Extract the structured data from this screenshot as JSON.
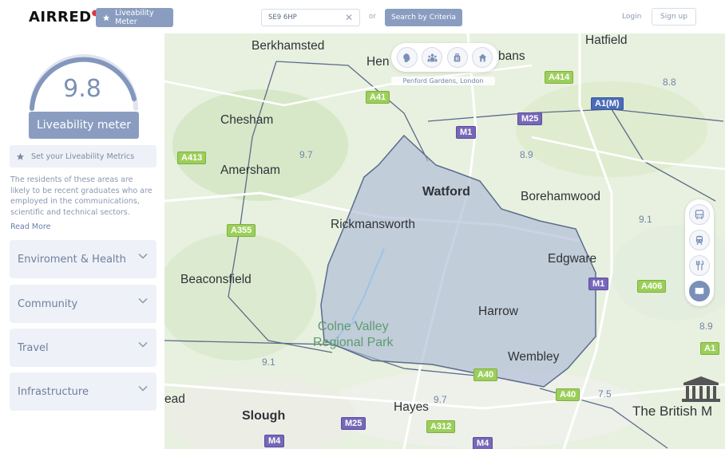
{
  "header": {
    "logo_text": "AIRRED",
    "meter_button": "Liveability Meter",
    "search": {
      "value": "SE9 6HP"
    },
    "or_text": "or",
    "criteria_button": "Search by Criteria",
    "login": "Login",
    "signup": "Sign up"
  },
  "sidebar": {
    "score": "9.8",
    "meter_label": "Liveability meter",
    "metrics_button": "Set your Liveability Metrics",
    "description": "The residents of these areas are likely to be recent graduates who are employed in the communications, scientific and technical sectors.",
    "read_more": "Read More",
    "sections": [
      "Enviroment & Health",
      "Community",
      "Travel",
      "Infrastructure"
    ]
  },
  "map": {
    "address": "Penford Gardens, London",
    "towns": [
      {
        "name": "Berkhamsted",
        "bold": false
      },
      {
        "name": "Hen",
        "bold": false
      },
      {
        "name": "bans",
        "bold": false
      },
      {
        "name": "Hatfield",
        "bold": false
      },
      {
        "name": "Chesham",
        "bold": false
      },
      {
        "name": "Amersham",
        "bold": false
      },
      {
        "name": "Watford",
        "bold": true
      },
      {
        "name": "Borehamwood",
        "bold": false
      },
      {
        "name": "Rickmansworth",
        "bold": false
      },
      {
        "name": "Edgware",
        "bold": false
      },
      {
        "name": "Beaconsfield",
        "bold": false
      },
      {
        "name": "Harrow",
        "bold": false
      },
      {
        "name": "Wembley",
        "bold": false
      },
      {
        "name": "ead",
        "bold": false
      },
      {
        "name": "Slough",
        "bold": true
      },
      {
        "name": "Hayes",
        "bold": false
      }
    ],
    "park": [
      "Colne Valley",
      "Regional Park"
    ],
    "scores": [
      "8.8",
      "9.7",
      "8.9",
      "9.1",
      "8.9",
      "9.1",
      "9.7",
      "7.5"
    ],
    "roads": [
      {
        "label": "A414",
        "kind": "a"
      },
      {
        "label": "A41",
        "kind": "a"
      },
      {
        "label": "M25",
        "kind": "m"
      },
      {
        "label": "A1(M)",
        "kind": "a1m"
      },
      {
        "label": "M1",
        "kind": "m"
      },
      {
        "label": "A413",
        "kind": "a"
      },
      {
        "label": "A355",
        "kind": "a"
      },
      {
        "label": "M1",
        "kind": "m"
      },
      {
        "label": "A406",
        "kind": "a"
      },
      {
        "label": "A1",
        "kind": "a"
      },
      {
        "label": "A40",
        "kind": "a"
      },
      {
        "label": "A40",
        "kind": "a"
      },
      {
        "label": "M25",
        "kind": "m"
      },
      {
        "label": "A312",
        "kind": "a"
      },
      {
        "label": "M4",
        "kind": "m"
      },
      {
        "label": "M4",
        "kind": "m"
      }
    ],
    "museum_label": "The British M"
  },
  "colors": {
    "accent": "#8a9dc0",
    "polygon_fill": "#a7b6d4",
    "polygon_stroke": "#5b6b8c"
  }
}
